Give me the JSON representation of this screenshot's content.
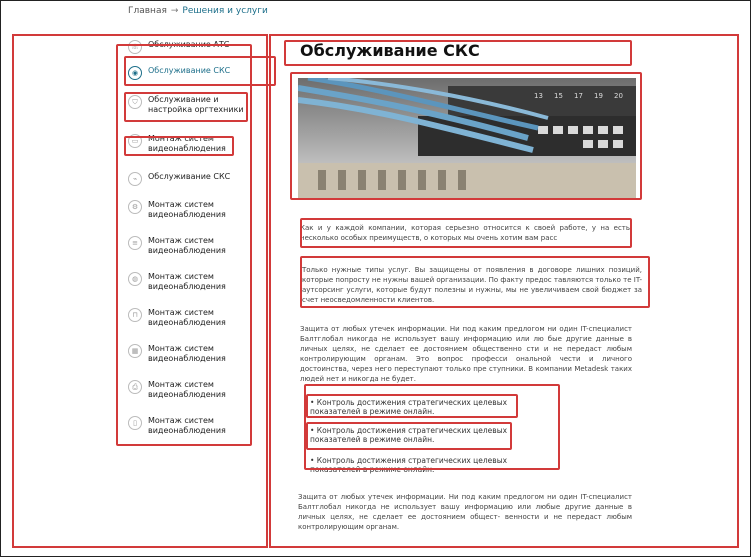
{
  "breadcrumb": {
    "home": "Главная",
    "arrow": "→",
    "current": "Решения и услуги"
  },
  "menu": [
    {
      "label": "Обслуживание АТС",
      "icon": "phone-icon"
    },
    {
      "label": "Обслуживание СКС",
      "icon": "network-icon",
      "active": true
    },
    {
      "label": "Обслуживание и настройка оргтехники",
      "icon": "shield-icon"
    },
    {
      "label": "Монтаж систем видеонаблюдения",
      "icon": "camera-icon"
    },
    {
      "label": "Обслуживание СКС",
      "icon": "plug-icon"
    },
    {
      "label": "Монтаж систем видеонаблюдения",
      "icon": "gear-icon"
    },
    {
      "label": "Монтаж систем видеонаблюдения",
      "icon": "server-icon"
    },
    {
      "label": "Монтаж систем видеонаблюдения",
      "icon": "globe-icon"
    },
    {
      "label": "Монтаж систем видеонаблюдения",
      "icon": "lock-icon"
    },
    {
      "label": "Монтаж систем видеонаблюдения",
      "icon": "grid-icon"
    },
    {
      "label": "Монтаж систем видеонаблюдения",
      "icon": "printer-icon"
    },
    {
      "label": "Монтаж систем видеонаблюдения",
      "icon": "document-icon"
    }
  ],
  "content": {
    "title": "Обслуживание СКС",
    "photo_numbers": [
      "13",
      "15",
      "17",
      "19",
      "20"
    ],
    "intro": "Как и у каждой компании, которая серьезно относится к своей работе, у на есть несколько особых преимуществ, о которых мы очень хотим вам расс",
    "intro_cut": "Только нужные типы услуг. Вы защищены от появления в договоре лишних позиций, которые попросту не нужны вашей организации. По факту предос тавляются только те IT-аутсорсинг услуги, которые будут полезны и нужны, мы не увеличиваем свой бюджет за счет неосведомленности клиентов.",
    "security": "Защита от любых утечек информации. Ни под каким предлогом ни один IT-специалист Балтглобал никогда не использует вашу информацию или лю бые другие данные в личных целях, не сделает ее достоянием общественно сти и не передаст любым контролирующим органам. Это вопрос профеcси ональной чести и личного достоинства, через него переступают только пре ступники. В компании Metadesk таких людей нет и никогда не будет.",
    "bullets": [
      "• Контроль достижения стратегических целевых показателей в режиме онлайн.",
      "• Контроль достижения стратегических целевых показателей в режиме онлайн.",
      "• Контроль достижения стратегических целевых показателей в режиме онлайн."
    ],
    "closing": "Защита от любых утечек информации. Ни под каким предлогом ни один IT-специалист Балтглобал никогда не использует вашу информацию или любые другие данные в личных целях, не сделает ее достоянием общест- венности и не передаст любым контролирующим органам."
  },
  "colors": {
    "accent": "#1d6f8a",
    "highlight": "#d23a3a"
  }
}
